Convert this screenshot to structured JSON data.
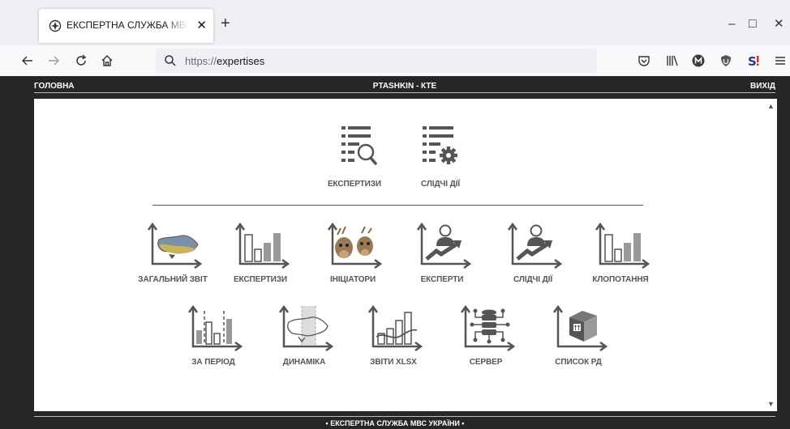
{
  "browser": {
    "tab_title": "ЕКСПЕРТНА СЛУЖБА МВС УКРАЇНИ",
    "new_tab": "+",
    "url_scheme": "https://",
    "url_path": "expertises",
    "min": "–",
    "max": "□",
    "close": "✕"
  },
  "header": {
    "home": "ГОЛОВНА",
    "user": "PTASHKIN - КТЕ",
    "exit": "ВИХІД"
  },
  "menu_top": [
    {
      "label": "ЕКСПЕРТИЗИ",
      "icon": "list-search-icon"
    },
    {
      "label": "СЛІДЧІ ДІЇ",
      "icon": "list-gear-icon"
    }
  ],
  "menu_row1": [
    {
      "label": "ЗАГАЛЬНИЙ ЗВІТ",
      "icon": "chart-map-icon"
    },
    {
      "label": "ЕКСПЕРТИЗИ",
      "icon": "chart-bars-icon"
    },
    {
      "label": "ІНІЦІАТОРИ",
      "icon": "chart-deer-icon"
    },
    {
      "label": "ЕКСПЕРТИ",
      "icon": "chart-person-trend-icon"
    },
    {
      "label": "СЛІДЧІ ДІЇ",
      "icon": "chart-person-trend-icon"
    },
    {
      "label": "КЛОПОТАННЯ",
      "icon": "chart-bars-icon"
    }
  ],
  "menu_row2": [
    {
      "label": "ЗА ПЕРІОД",
      "icon": "chart-period-icon"
    },
    {
      "label": "ДИНАМІКА",
      "icon": "chart-dynamics-map-icon"
    },
    {
      "label": "ЗВІТИ XLSX",
      "icon": "chart-bars-curve-icon"
    },
    {
      "label": "СЕРВЕР",
      "icon": "chart-database-icon"
    },
    {
      "label": "СПИСОК РД",
      "icon": "chart-box-icon"
    }
  ],
  "footer": "• ЕКСПЕРТНА СЛУЖБА МВС УКРАЇНИ •",
  "colors": {
    "page_bg": "#262626",
    "icon": "#555555",
    "icon_accent": "#999999"
  }
}
